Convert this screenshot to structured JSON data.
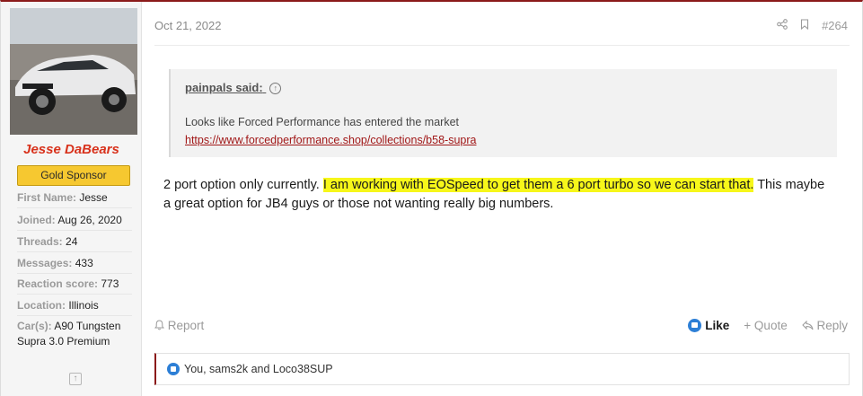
{
  "sidebar": {
    "username": "Jesse DaBears",
    "badge": "Gold Sponsor",
    "stats": [
      {
        "label": "First Name:",
        "value": "Jesse"
      },
      {
        "label": "Joined:",
        "value": "Aug 26, 2020"
      },
      {
        "label": "Threads:",
        "value": "24"
      },
      {
        "label": "Messages:",
        "value": "433"
      },
      {
        "label": "Reaction score:",
        "value": "773"
      },
      {
        "label": "Location:",
        "value": "Illinois"
      },
      {
        "label": "Car(s):",
        "value": "A90 Tungsten Supra 3.0 Premium"
      }
    ],
    "scroll_up_glyph": "↑"
  },
  "post": {
    "date": "Oct 21, 2022",
    "number": "#264",
    "share_icon": "share-icon",
    "bookmark_icon": "bookmark-icon",
    "quote": {
      "author": "painpals said:",
      "arrow_glyph": "↑",
      "text": "Looks like Forced Performance has entered the market",
      "link": "https://www.forcedperformance.shop/collections/b58-supra"
    },
    "message": {
      "part1": "2 port option only currently. ",
      "highlight": "I am working with EOSpeed to get them a 6 port turbo so we can start that.",
      "part2": " This maybe a great option for JB4 guys or those not wanting really big numbers."
    },
    "footer": {
      "report": "Report",
      "like": "Like",
      "quote": "+ Quote",
      "reply": "Reply"
    },
    "reactions": "You, sams2k and Loco38SUP"
  },
  "colors": {
    "accent": "#8b1a1a",
    "username": "#d8321c",
    "badge": "#f6c830",
    "highlight": "#f7f71a",
    "like_blue": "#2d7fd6"
  }
}
